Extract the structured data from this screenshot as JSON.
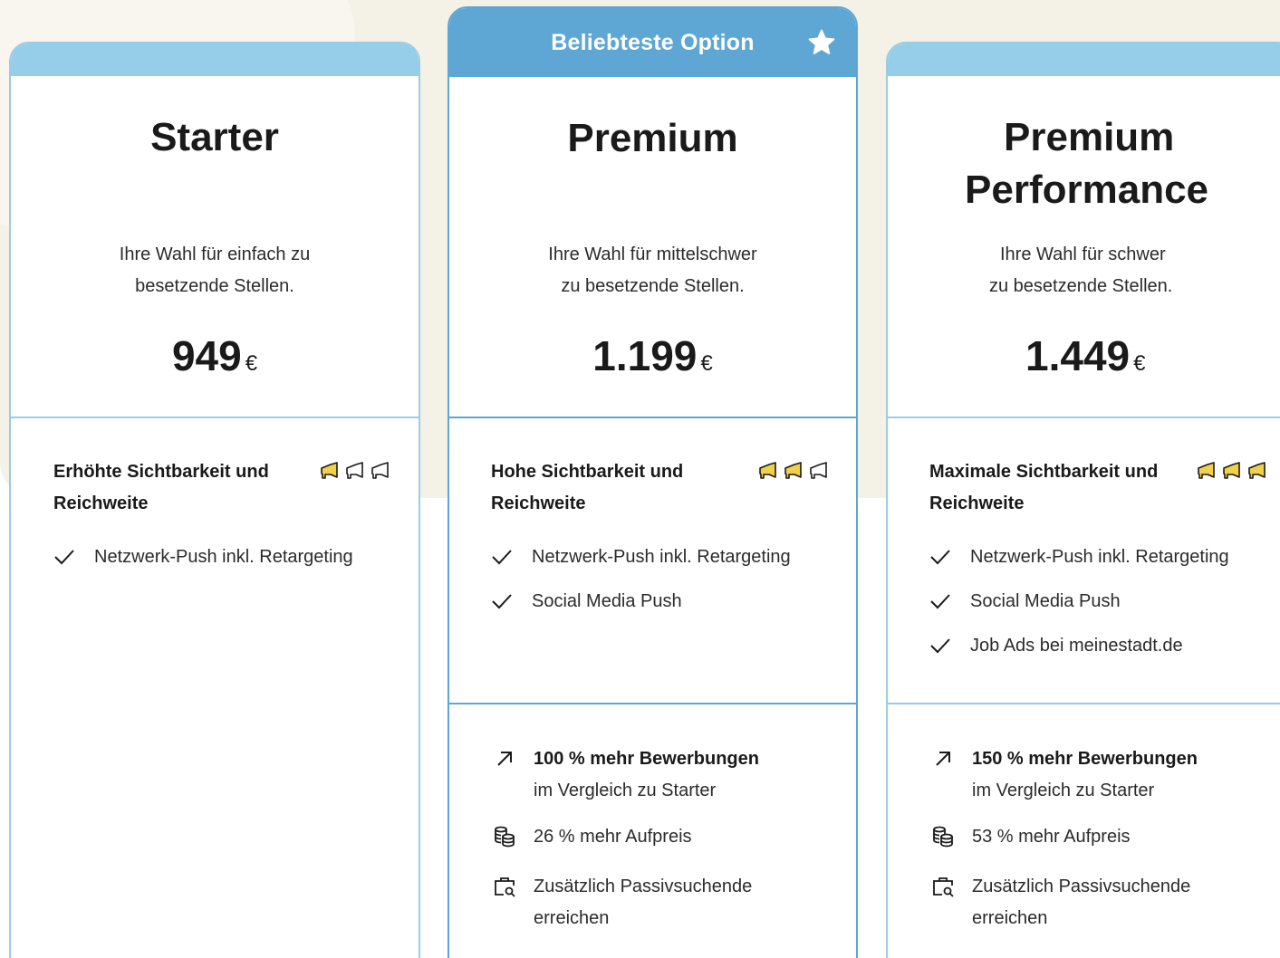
{
  "colors": {
    "accent": "#5ea6d4",
    "accent_light": "#96cde8",
    "megaphone_active": "#f2d14a",
    "background": "#f4f1e7"
  },
  "popular_badge": "Beliebteste Option",
  "plans": [
    {
      "name_lines": [
        "Starter"
      ],
      "desc_lines": [
        "Ihre Wahl für einfach zu",
        "besetzende Stellen."
      ],
      "price": "949",
      "currency": "€",
      "feature_head": "Erhöhte Sichtbarkeit und Reichweite",
      "megaphones_active": 1,
      "features": [
        "Netzwerk-Push inkl. Retargeting"
      ]
    },
    {
      "name_lines": [
        "Premium"
      ],
      "desc_lines": [
        "Ihre Wahl für mittelschwer",
        "zu besetzende Stellen."
      ],
      "price": "1.199",
      "currency": "€",
      "feature_head": "Hohe Sichtbarkeit und Reichweite",
      "megaphones_active": 2,
      "features": [
        "Netzwerk-Push inkl. Retargeting",
        "Social Media Push"
      ],
      "extras": {
        "growth_bold": "100 % mehr Bewerbungen",
        "growth_rest": "im Vergleich zu Starter",
        "surcharge": "26 % mehr Aufpreis",
        "passive": "Zusätzlich Passivsuchende erreichen"
      }
    },
    {
      "name_lines": [
        "Premium",
        "Performance"
      ],
      "desc_lines": [
        "Ihre Wahl für schwer",
        "zu besetzende Stellen."
      ],
      "price": "1.449",
      "currency": "€",
      "feature_head": "Maximale Sichtbarkeit und Reichweite",
      "megaphones_active": 3,
      "features": [
        "Netzwerk-Push inkl. Retargeting",
        "Social Media Push",
        "Job Ads bei meinestadt.de"
      ],
      "extras": {
        "growth_bold": "150 % mehr Bewerbungen",
        "growth_rest": "im Vergleich zu Starter",
        "surcharge": "53 % mehr Aufpreis",
        "passive": "Zusätzlich Passivsuchende erreichen"
      }
    }
  ]
}
